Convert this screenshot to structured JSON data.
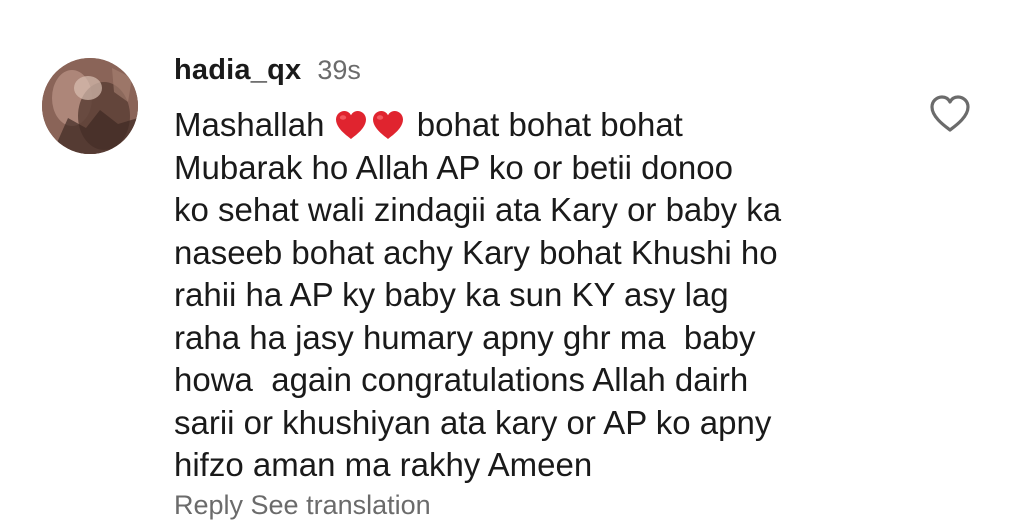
{
  "comment": {
    "username": "hadia_qx",
    "timestamp": "39s",
    "text_lead": "Mashallah",
    "emoji": [
      "red-heart",
      "red-heart"
    ],
    "lines": [
      " bohat bohat bohat",
      "Mubarak ho Allah AP ko or betii donoo",
      "ko sehat wali zindagii ata Kary or baby ka",
      "naseeb bohat achy Kary bohat Khushi ho",
      "rahii ha AP ky baby ka sun KY asy lag",
      "raha ha jasy humary apny ghr ma  baby",
      "howa  again congratulations Allah dairh",
      "sarii or khushiyan ata kary or AP ko apny",
      "hifzo aman ma rakhy Ameen"
    ],
    "reply_label": "Reply   See translation",
    "like_icon": "heart-outline-icon",
    "heart_color": "#e0242f",
    "muted_color": "#6b6b6b"
  }
}
